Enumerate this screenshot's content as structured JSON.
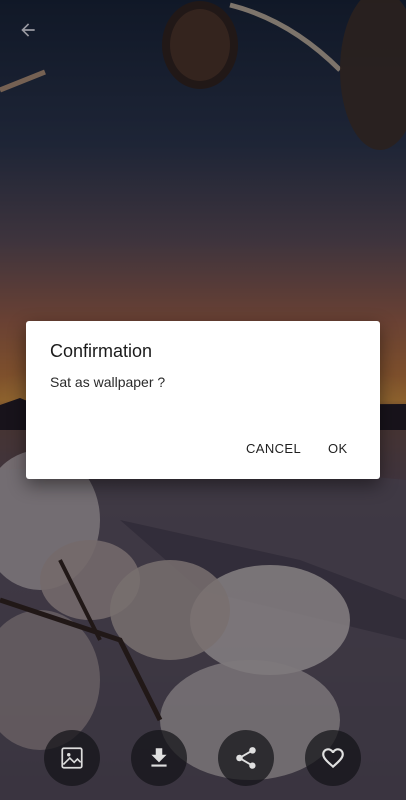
{
  "dialog": {
    "title": "Confirmation",
    "message": "Sat as wallpaper ?",
    "cancel_label": "CANCEL",
    "ok_label": "OK"
  },
  "toolbar": {
    "icons": [
      "set-wallpaper-icon",
      "download-icon",
      "share-icon",
      "favorite-heart-icon"
    ]
  },
  "colors": {
    "dialog_background": "#ffffff",
    "text_primary": "#1b1b1b",
    "fab_background": "#141418",
    "icon_color": "#e0e0e0"
  }
}
